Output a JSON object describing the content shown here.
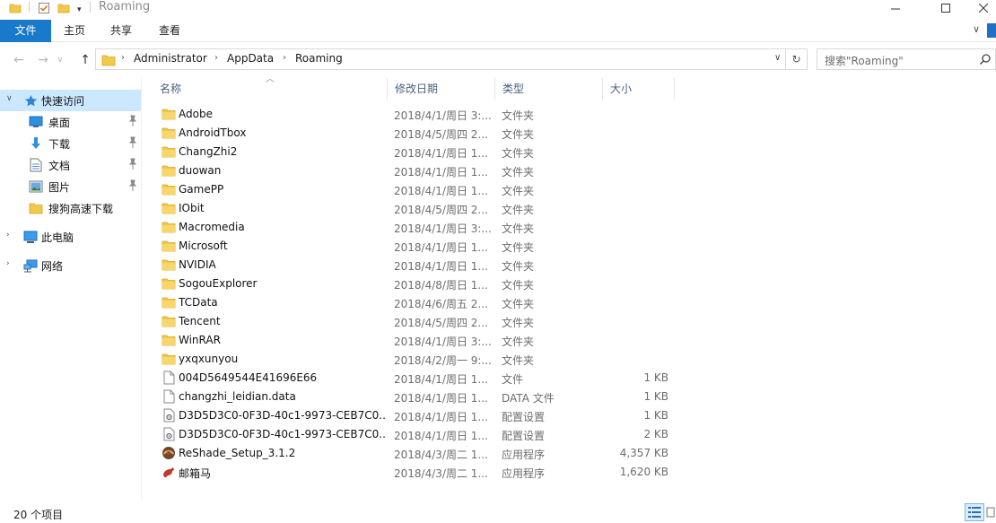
{
  "window": {
    "title": "Roaming"
  },
  "ribbon": {
    "tabs": [
      {
        "label": "文件"
      },
      {
        "label": "主页"
      },
      {
        "label": "共享"
      },
      {
        "label": "查看"
      }
    ]
  },
  "address": {
    "crumbs": [
      "Administrator",
      "AppData",
      "Roaming"
    ]
  },
  "search": {
    "placeholder": "搜索\"Roaming\""
  },
  "sidebar": {
    "items": [
      {
        "label": "快速访问",
        "icon": "star-icon"
      },
      {
        "label": "桌面",
        "icon": "desktop-icon",
        "pinned": true
      },
      {
        "label": "下载",
        "icon": "download-icon",
        "pinned": true
      },
      {
        "label": "文档",
        "icon": "document-icon",
        "pinned": true
      },
      {
        "label": "图片",
        "icon": "picture-icon",
        "pinned": true
      },
      {
        "label": "搜狗高速下载",
        "icon": "folder-icon",
        "pinned": false
      },
      {
        "label": "此电脑",
        "icon": "computer-icon"
      },
      {
        "label": "网络",
        "icon": "network-icon"
      }
    ]
  },
  "columns": {
    "name": "名称",
    "date": "修改日期",
    "type": "类型",
    "size": "大小"
  },
  "files": [
    {
      "name": "Adobe",
      "date": "2018/4/1/周日 3:...",
      "type": "文件夹",
      "size": "",
      "icon": "folder-icon"
    },
    {
      "name": "AndroidTbox",
      "date": "2018/4/5/周四 2...",
      "type": "文件夹",
      "size": "",
      "icon": "folder-icon"
    },
    {
      "name": "ChangZhi2",
      "date": "2018/4/1/周日 1...",
      "type": "文件夹",
      "size": "",
      "icon": "folder-icon"
    },
    {
      "name": "duowan",
      "date": "2018/4/1/周日 1...",
      "type": "文件夹",
      "size": "",
      "icon": "folder-icon"
    },
    {
      "name": "GamePP",
      "date": "2018/4/1/周日 1...",
      "type": "文件夹",
      "size": "",
      "icon": "folder-icon"
    },
    {
      "name": "IObit",
      "date": "2018/4/5/周四 2...",
      "type": "文件夹",
      "size": "",
      "icon": "folder-icon"
    },
    {
      "name": "Macromedia",
      "date": "2018/4/1/周日 3:...",
      "type": "文件夹",
      "size": "",
      "icon": "folder-icon"
    },
    {
      "name": "Microsoft",
      "date": "2018/4/1/周日 1...",
      "type": "文件夹",
      "size": "",
      "icon": "folder-icon"
    },
    {
      "name": "NVIDIA",
      "date": "2018/4/1/周日 1...",
      "type": "文件夹",
      "size": "",
      "icon": "folder-icon"
    },
    {
      "name": "SogouExplorer",
      "date": "2018/4/8/周日 1...",
      "type": "文件夹",
      "size": "",
      "icon": "folder-icon"
    },
    {
      "name": "TCData",
      "date": "2018/4/6/周五 2...",
      "type": "文件夹",
      "size": "",
      "icon": "folder-icon"
    },
    {
      "name": "Tencent",
      "date": "2018/4/5/周四 2...",
      "type": "文件夹",
      "size": "",
      "icon": "folder-icon"
    },
    {
      "name": "WinRAR",
      "date": "2018/4/1/周日 3:...",
      "type": "文件夹",
      "size": "",
      "icon": "folder-icon"
    },
    {
      "name": "yxqxunyou",
      "date": "2018/4/2/周一 9:...",
      "type": "文件夹",
      "size": "",
      "icon": "folder-icon"
    },
    {
      "name": "004D5649544E41696E66",
      "date": "2018/4/1/周日 1...",
      "type": "文件",
      "size": "1 KB",
      "icon": "file-icon"
    },
    {
      "name": "changzhi_leidian.data",
      "date": "2018/4/1/周日 1...",
      "type": "DATA 文件",
      "size": "1 KB",
      "icon": "file-icon"
    },
    {
      "name": "D3D5D3C0-0F3D-40c1-9973-CEB7C0...",
      "date": "2018/4/1/周日 1...",
      "type": "配置设置",
      "size": "1 KB",
      "icon": "config-file-icon"
    },
    {
      "name": "D3D5D3C0-0F3D-40c1-9973-CEB7C0...",
      "date": "2018/4/1/周日 1...",
      "type": "配置设置",
      "size": "2 KB",
      "icon": "config-file-icon"
    },
    {
      "name": "ReShade_Setup_3.1.2",
      "date": "2018/4/3/周二 1...",
      "type": "应用程序",
      "size": "4,357 KB",
      "icon": "reshade-app-icon"
    },
    {
      "name": "邮箱马",
      "date": "2018/4/3/周二 1...",
      "type": "应用程序",
      "size": "1,620 KB",
      "icon": "horse-app-icon"
    }
  ],
  "status": {
    "item_count": "20 个项目"
  },
  "colors": {
    "accent": "#1979ca",
    "selection": "#cce8ff",
    "folder": "#f2c94c",
    "header_text": "#4c607a",
    "muted_text": "#6d6d6d"
  }
}
